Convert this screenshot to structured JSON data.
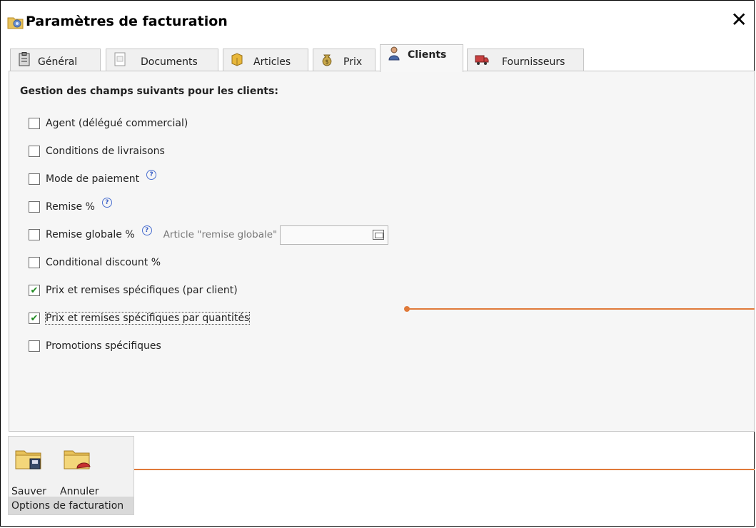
{
  "window": {
    "title": "Paramètres de facturation",
    "close_symbol": "✕"
  },
  "tabs": [
    {
      "label": "Général",
      "icon": "clipboard-icon"
    },
    {
      "label": "Documents",
      "icon": "document-icon"
    },
    {
      "label": "Articles",
      "icon": "box-icon"
    },
    {
      "label": "Prix",
      "icon": "money-bag-icon"
    },
    {
      "label": "Clients",
      "icon": "user-icon",
      "active": true
    },
    {
      "label": "Fournisseurs",
      "icon": "truck-icon"
    }
  ],
  "section_title": "Gestion des champs suivants pour les clients:",
  "options": [
    {
      "label": "Agent (délégué commercial)",
      "checked": false,
      "help": false
    },
    {
      "label": "Conditions de livraisons",
      "checked": false,
      "help": false
    },
    {
      "label": "Mode de paiement",
      "checked": false,
      "help": true
    },
    {
      "label": "Remise %",
      "checked": false,
      "help": true
    },
    {
      "label": "Remise globale %",
      "checked": false,
      "help": true
    },
    {
      "label": "Conditional discount %",
      "checked": false,
      "help": false
    },
    {
      "label": "Prix et remises spécifiques (par client)",
      "checked": true,
      "help": false
    },
    {
      "label": "Prix et remises spécifiques par quantités",
      "checked": true,
      "help": false
    },
    {
      "label": "Promotions spécifiques",
      "checked": false,
      "help": false
    }
  ],
  "article_remise_label": "Article \"remise globale\"",
  "article_remise_value": "",
  "toolbar": {
    "save_label": "Sauver",
    "cancel_label": "Annuler",
    "group_label": "Options de facturation"
  },
  "colors": {
    "annotation": "#e07a3a",
    "check": "#1f8a20",
    "help": "#3a5fc7"
  }
}
